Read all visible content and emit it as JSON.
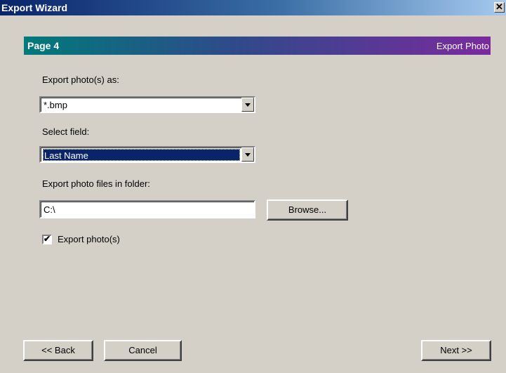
{
  "window": {
    "title": "Export Wizard",
    "close_glyph": "✕"
  },
  "banner": {
    "page": "Page 4",
    "name": "Export Photo"
  },
  "format": {
    "label": "Export photo(s) as:",
    "value": "*.bmp"
  },
  "field": {
    "label": "Select field:",
    "value": "Last Name"
  },
  "folder": {
    "label": "Export photo files in folder:",
    "value": "C:\\",
    "browse_label": "Browse..."
  },
  "export_checkbox": {
    "label": "Export photo(s)",
    "checked": true
  },
  "footer": {
    "back_label": "<< Back",
    "cancel_label": "Cancel",
    "next_label": "Next >>"
  }
}
